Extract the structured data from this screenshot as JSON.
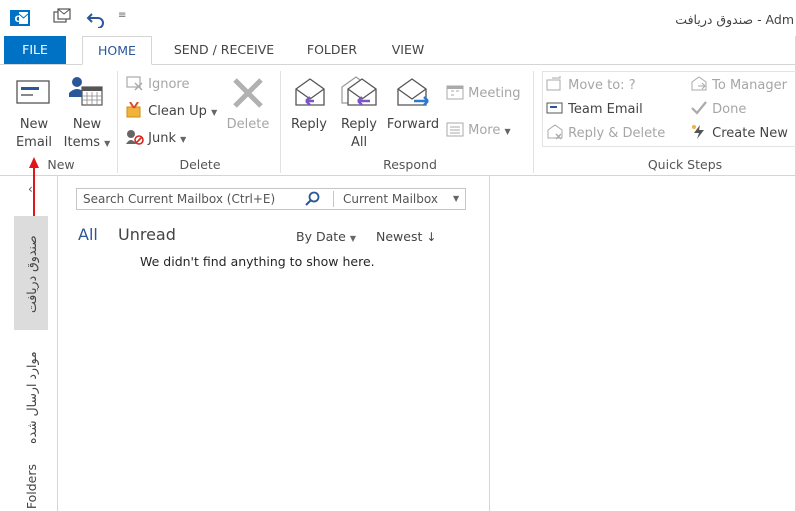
{
  "window": {
    "title": "صندوق دریافت - Adm"
  },
  "tabs": [
    "FILE",
    "HOME",
    "SEND / RECEIVE",
    "FOLDER",
    "VIEW"
  ],
  "ribbon": {
    "new_group": {
      "label": "New",
      "new_email": [
        "New",
        "Email"
      ],
      "new_items": [
        "New",
        "Items"
      ]
    },
    "delete_group": {
      "label": "Delete",
      "ignore": "Ignore",
      "clean_up": "Clean Up",
      "junk": "Junk",
      "delete": "Delete"
    },
    "respond_group": {
      "label": "Respond",
      "reply": "Reply",
      "reply_all": [
        "Reply",
        "All"
      ],
      "forward": "Forward",
      "meeting": "Meeting",
      "more": "More"
    },
    "quick_steps": {
      "label": "Quick Steps",
      "move_to": "Move to: ?",
      "team_email": "Team Email",
      "reply_delete": "Reply & Delete",
      "to_manager": "To Manager",
      "done": "Done",
      "create_new": "Create New"
    }
  },
  "nav": {
    "inbox": "صندوق دریافت",
    "sent": "موارد ارسال شده",
    "folders": "Folders",
    "collapse": "‹"
  },
  "search": {
    "placeholder": "Search Current Mailbox (Ctrl+E)",
    "scope": "Current Mailbox"
  },
  "list": {
    "filter_all": "All",
    "filter_unread": "Unread",
    "sort_by": "By Date",
    "order": "Newest",
    "empty_message": "We didn't find anything to show here."
  },
  "colors": {
    "file_tab": "#0072c6",
    "accent": "#2b579a",
    "annotation_arrow": "#e0161b"
  }
}
